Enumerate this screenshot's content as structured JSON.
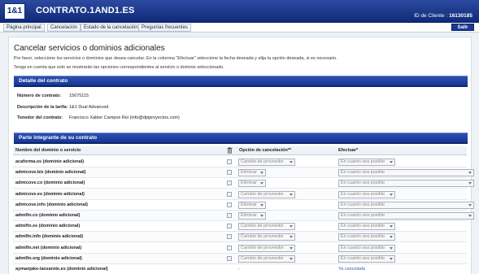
{
  "header": {
    "logo": "1&1",
    "title": "CONTRATO.1AND1.ES",
    "client_label": "ID de Cliente :",
    "client_id": "16130185"
  },
  "nav": {
    "items": [
      "Página principal",
      "Cancelación",
      "Estado de la cancelación",
      "Preguntas frecuentes"
    ],
    "exit_label": "Salir"
  },
  "page": {
    "title": "Cancelar servicios o dominios adicionales",
    "intro1": "Por favor, seleccione los servicios o dominios que desea cancelar. En la columna \"Efectuar\" seleccione la fecha deseada y elija la opción deseada, si es necesario.",
    "intro2": "Tenga en cuenta que solo se mostrarán las opciones correspondientes al servicio o dominio seleccionado."
  },
  "contract": {
    "heading": "Detalle del contrato",
    "number_label": "Número de contrato:",
    "number": "15675115",
    "tariff_label": "Descripción de la tarifa:",
    "tariff": "1&1 Dual Advanced",
    "holder_label": "Tenedor del contrato:",
    "holder": "Francisco Xabier Campos Rei (info@dpiproyectos.com)"
  },
  "table": {
    "heading": "Parte integrante de su contrato",
    "col_domain": "Nombre del dominio o servicio",
    "col_option": "Opción de cancelación**",
    "col_effect": "Efectuar*",
    "rows": [
      {
        "domain": "acaforma.es (dominio adicional)",
        "option": "Cambio de proveedor",
        "effect": "En cuanto sea posible",
        "wide": false,
        "cancelled": false
      },
      {
        "domain": "admicove.biz (dominio adicional)",
        "option": "Eliminar",
        "effect": "En cuanto sea posible",
        "wide": true,
        "cancelled": false
      },
      {
        "domain": "admicove.co (dominio adicional)",
        "option": "Eliminar",
        "effect": "En cuanto sea posible",
        "wide": true,
        "cancelled": false
      },
      {
        "domain": "admicove.es (dominio adicional)",
        "option": "Cambio de proveedor",
        "effect": "En cuanto sea posible",
        "wide": false,
        "cancelled": false
      },
      {
        "domain": "admicove.info (dominio adicional)",
        "option": "Eliminar",
        "effect": "En cuanto sea posible",
        "wide": true,
        "cancelled": false
      },
      {
        "domain": "admifin.co (dominio adicional)",
        "option": "Eliminar",
        "effect": "En cuanto sea posible",
        "wide": true,
        "cancelled": false
      },
      {
        "domain": "admifin.es (dominio adicional)",
        "option": "Cambio de proveedor",
        "effect": "En cuanto sea posible",
        "wide": false,
        "cancelled": false
      },
      {
        "domain": "admifin.info (dominio adicional)",
        "option": "Cambio de proveedor",
        "effect": "En cuanto sea posible",
        "wide": false,
        "cancelled": false
      },
      {
        "domain": "admifin.net (dominio adicional)",
        "option": "Cambio de proveedor",
        "effect": "En cuanto sea posible",
        "wide": false,
        "cancelled": false
      },
      {
        "domain": "admifin.org (dominio adicional)",
        "option": "Cambio de proveedor",
        "effect": "En cuanto sea posible",
        "wide": false,
        "cancelled": false
      },
      {
        "domain": "aymanjake-lanzarote.es (dominio adicional)",
        "option": "-",
        "effect": "Ya cancelada",
        "wide": false,
        "cancelled": true
      }
    ]
  },
  "colors": {
    "header_blue": "#163795",
    "accent": "#17389a",
    "link": "#3b5bb5"
  }
}
